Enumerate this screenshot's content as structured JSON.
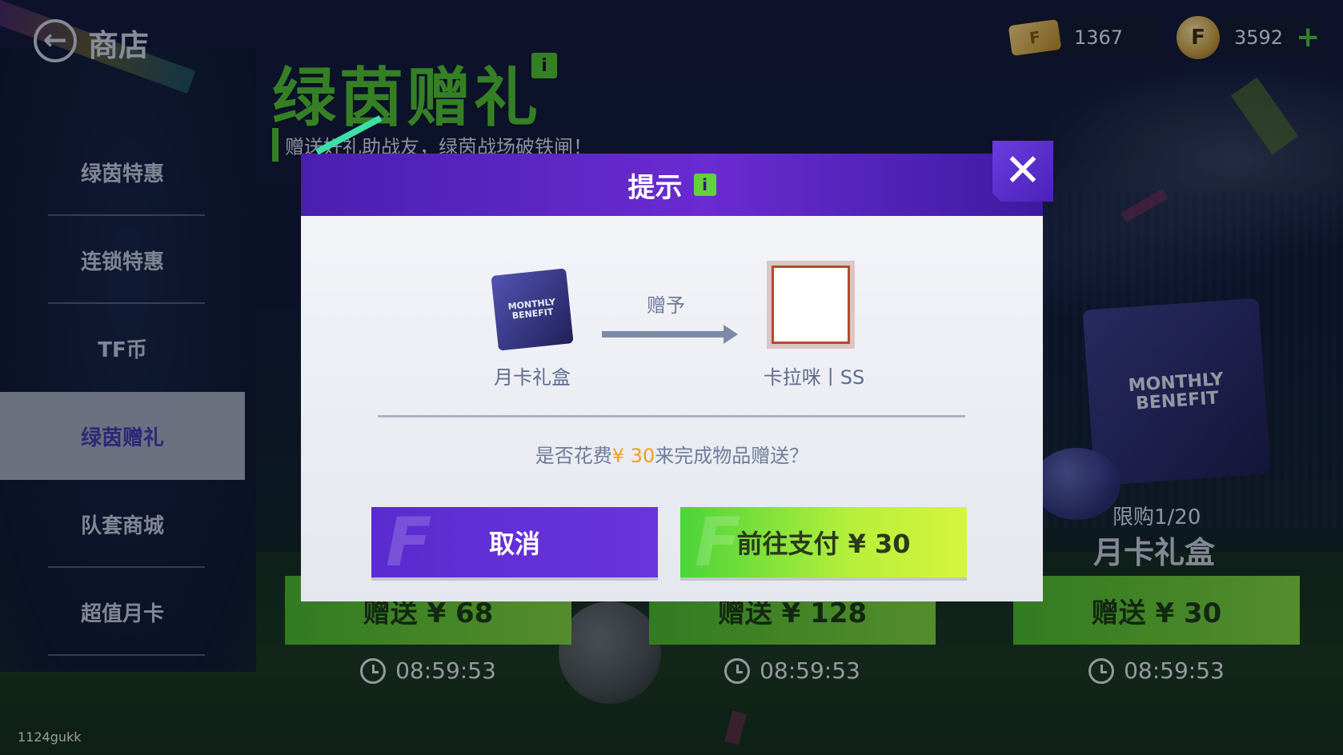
{
  "header": {
    "back_label": "商店",
    "tickets": "1367",
    "coins": "3592",
    "plus": "+"
  },
  "sidebar": {
    "items": [
      {
        "label": "绿茵特惠"
      },
      {
        "label": "连锁特惠"
      },
      {
        "label": "TF币"
      },
      {
        "label": "绿茵赠礼"
      },
      {
        "label": "队套商城"
      },
      {
        "label": "超值月卡"
      }
    ],
    "active_index": 3
  },
  "page": {
    "title": "绿茵赠礼",
    "info": "i",
    "subtitle": "赠送好礼助战友，绿茵战场破铁闸！"
  },
  "shop": {
    "box_art": "MONTHLY BENEFIT",
    "limit": "限购1/20",
    "card_name": "月卡礼盒",
    "buttons": [
      "赠送 ¥ 68",
      "赠送 ¥ 128",
      "赠送 ¥ 30"
    ],
    "timers": [
      "08:59:53",
      "08:59:53",
      "08:59:53"
    ]
  },
  "watermark": "1124gukk",
  "modal": {
    "title": "提示",
    "info": "i",
    "close": "✕",
    "item_art": "MONTHLY BENEFIT",
    "item_name": "月卡礼盒",
    "give_label": "赠予",
    "friend_name": "卡拉咪丨SS",
    "question_pre": "是否花费",
    "question_price": "¥ 30",
    "question_post": "来完成物品赠送？",
    "cancel": "取消",
    "pay": "前往支付 ¥ 30",
    "btn_letter": "F"
  },
  "colors": {
    "accent_green": "#4fc12f",
    "modal_purple": "#5a2bd0",
    "price_orange": "#f0a020"
  },
  "icons": {
    "back": "back-arrow-icon",
    "ticket": "ticket-icon",
    "coin": "f-coin-icon",
    "clock": "clock-icon",
    "close": "close-icon"
  }
}
